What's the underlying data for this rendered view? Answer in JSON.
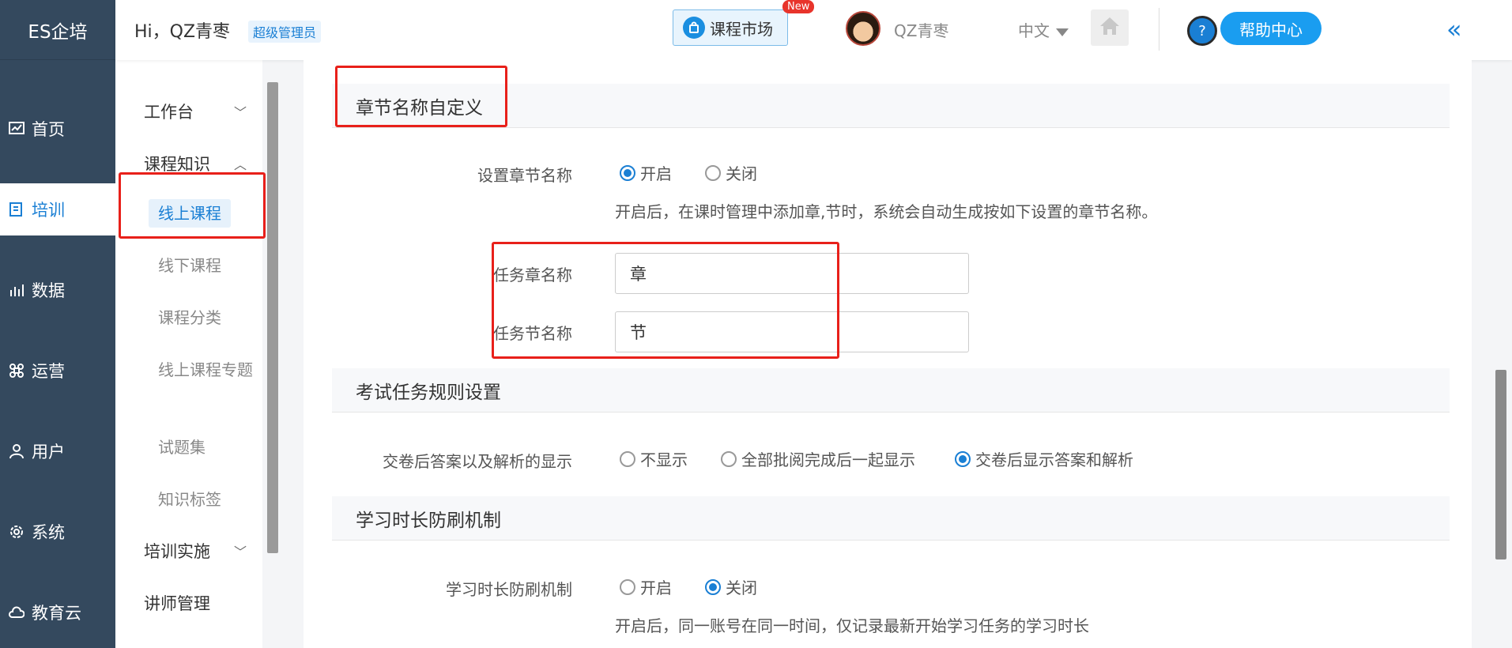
{
  "app": {
    "logo": "ES企培"
  },
  "nav": {
    "items": [
      {
        "label": "首页",
        "icon": "chart-icon"
      },
      {
        "label": "培训",
        "icon": "book-icon"
      },
      {
        "label": "数据",
        "icon": "bar-chart-icon"
      },
      {
        "label": "运营",
        "icon": "command-icon"
      },
      {
        "label": "用户",
        "icon": "user-icon"
      },
      {
        "label": "系统",
        "icon": "gear-icon"
      },
      {
        "label": "教育云",
        "icon": "cloud-icon"
      }
    ]
  },
  "submenu": {
    "groups": [
      {
        "label": "工作台",
        "expanded": false
      },
      {
        "label": "课程知识",
        "expanded": true
      },
      {
        "label": "培训实施",
        "expanded": false
      },
      {
        "label": "讲师管理"
      }
    ],
    "items": [
      "线上课程",
      "线下课程",
      "课程分类",
      "线上课程专题",
      "试题集",
      "知识标签"
    ],
    "active": "线上课程"
  },
  "header": {
    "greeting": "Hi，QZ青枣",
    "role": "超级管理员",
    "market": "课程市场",
    "new_badge": "New",
    "username": "QZ青枣",
    "language": "中文",
    "help": "帮助中心",
    "help_q": "?",
    "collapse": "«"
  },
  "sections": {
    "chapter": {
      "title": "章节名称自定义",
      "set_label": "设置章节名称",
      "on": "开启",
      "off": "关闭",
      "selected": "开启",
      "hint": "开启后，在课时管理中添加章,节时，系统会自动生成按如下设置的章节名称。",
      "chapter_label": "任务章名称",
      "chapter_value": "章",
      "section_label": "任务节名称",
      "section_value": "节"
    },
    "exam": {
      "title": "考试任务规则设置",
      "label": "交卷后答案以及解析的显示",
      "options": [
        "不显示",
        "全部批阅完成后一起显示",
        "交卷后显示答案和解析"
      ],
      "selected": "交卷后显示答案和解析"
    },
    "study": {
      "title": "学习时长防刷机制",
      "label": "学习时长防刷机制",
      "on": "开启",
      "off": "关闭",
      "selected": "关闭",
      "hint": "开启后，同一账号在同一时间，仅记录最新开始学习任务的学习时长"
    }
  },
  "colors": {
    "accent": "#1a7fd4",
    "nav_bg": "#34495e",
    "highlight": "#e8201a"
  }
}
